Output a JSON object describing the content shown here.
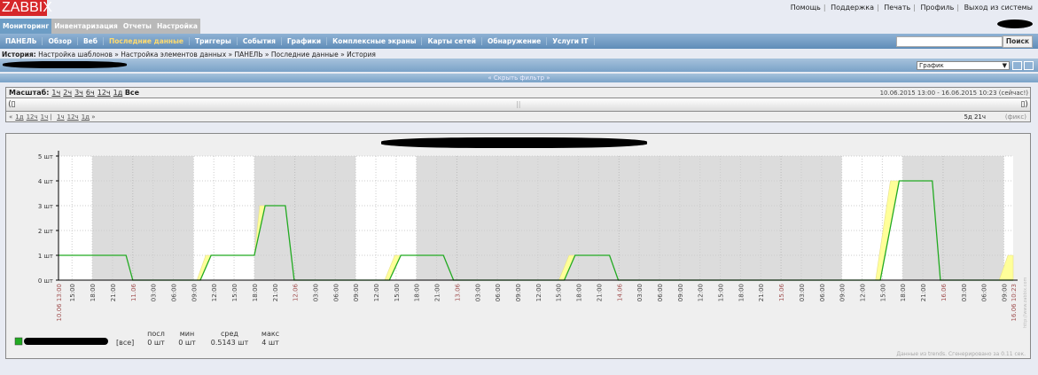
{
  "logo": "ZABBIX",
  "top_links": [
    "Помощь",
    "Поддержка",
    "Печать",
    "Профиль",
    "Выход из системы"
  ],
  "main_tabs": [
    {
      "label": "Мониторинг",
      "active": true
    },
    {
      "label": "Инвентаризация"
    },
    {
      "label": "Отчеты"
    },
    {
      "label": "Настройка"
    }
  ],
  "sub_nav": [
    {
      "label": "ПАНЕЛЬ"
    },
    {
      "label": "Обзор"
    },
    {
      "label": "Веб"
    },
    {
      "label": "Последние данные",
      "active": true
    },
    {
      "label": "Триггеры"
    },
    {
      "label": "События"
    },
    {
      "label": "Графики"
    },
    {
      "label": "Комплексные экраны"
    },
    {
      "label": "Карты сетей"
    },
    {
      "label": "Обнаружение"
    },
    {
      "label": "Услуги IT"
    }
  ],
  "search": {
    "value": "",
    "button": "Поиск"
  },
  "breadcrumb": {
    "label": "История:",
    "items": [
      "Настройка шаблонов",
      "Настройка элементов данных",
      "ПАНЕЛЬ",
      "Последние данные",
      "История"
    ],
    "sep": "»"
  },
  "graph_type": "График",
  "filter_toggle": "« Скрыть фильтр »",
  "filter": {
    "scale_label": "Масштаб:",
    "scale_links": [
      "1ч",
      "2ч",
      "3ч",
      "6ч",
      "12ч",
      "1д"
    ],
    "scale_all": "Все",
    "period": "10.06.2015 13:00  -  16.06.2015 10:23 (сейчас!)",
    "nav_back": [
      "«",
      "1д",
      "12ч",
      "1ч"
    ],
    "nav_fwd": [
      "1ч",
      "12ч",
      "1д",
      "»"
    ],
    "duration": "5д 21ч",
    "fix": "(фикс)"
  },
  "legend": {
    "range": "[все]",
    "headers": [
      "посл",
      "мин",
      "сред",
      "макс"
    ],
    "values": [
      "0 шт",
      "0 шт",
      "0.5143 шт",
      "4 шт"
    ],
    "color": "#22aa22"
  },
  "footer": "Данные из trends. Сгенерировано за 0.11 сек.",
  "watermark": "http://www.zabbix.com",
  "chart_data": {
    "type": "line",
    "x_unit": "hours since 10.06 13:00",
    "xlim": [
      0,
      141.38
    ],
    "ylim": [
      0,
      5
    ],
    "yticks": [
      "0 шт",
      "1 шт",
      "2 шт",
      "3 шт",
      "4 шт",
      "5 шт"
    ],
    "x_start_label": "10.06 13:00",
    "x_end_label": "16.06 10:23",
    "day_labels": [
      "11.06",
      "12.06",
      "13.06",
      "14.06",
      "15.06",
      "16.06"
    ],
    "series": [
      {
        "name": "avg",
        "color": "#22aa22",
        "points": [
          [
            0,
            1
          ],
          [
            10,
            1
          ],
          [
            11,
            0
          ],
          [
            21,
            0
          ],
          [
            22.6,
            1
          ],
          [
            29,
            1
          ],
          [
            30.6,
            3
          ],
          [
            33.6,
            3
          ],
          [
            34.9,
            0
          ],
          [
            49,
            0
          ],
          [
            50.7,
            1
          ],
          [
            57,
            1
          ],
          [
            58.5,
            0
          ],
          [
            74.9,
            0
          ],
          [
            76.5,
            1
          ],
          [
            81.6,
            1
          ],
          [
            82.9,
            0
          ],
          [
            121.7,
            0
          ],
          [
            124.5,
            4
          ],
          [
            129.4,
            4
          ],
          [
            130.6,
            0
          ],
          [
            141.38,
            0
          ]
        ]
      },
      {
        "name": "max",
        "color": "#ffff99",
        "points": [
          [
            0,
            1
          ],
          [
            10,
            1
          ],
          [
            11,
            0
          ],
          [
            20.5,
            0
          ],
          [
            21.8,
            1
          ],
          [
            29,
            1
          ],
          [
            29.8,
            3
          ],
          [
            33.6,
            3
          ],
          [
            34.9,
            0
          ],
          [
            48.3,
            0
          ],
          [
            49.8,
            1
          ],
          [
            57,
            1
          ],
          [
            58.5,
            0
          ],
          [
            74.1,
            0
          ],
          [
            75.6,
            1
          ],
          [
            81.6,
            1
          ],
          [
            82.9,
            0
          ],
          [
            121,
            0
          ],
          [
            123.2,
            4
          ],
          [
            129.4,
            4
          ],
          [
            130.6,
            0
          ],
          [
            139.3,
            0
          ],
          [
            140.6,
            1
          ],
          [
            141.38,
            1
          ]
        ]
      }
    ],
    "off_hours": [
      [
        5,
        20
      ],
      [
        29,
        44
      ],
      [
        53,
        116
      ],
      [
        125,
        140
      ]
    ]
  }
}
